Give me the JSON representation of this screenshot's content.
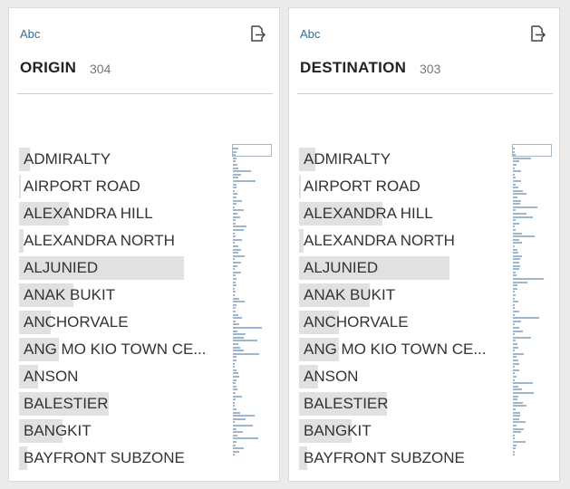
{
  "cards": [
    {
      "type_label": "Abc",
      "title": "ORIGIN",
      "count": "304",
      "values": [
        {
          "label": "ADMIRALTY",
          "freq": 0.05
        },
        {
          "label": "AIRPORT ROAD",
          "freq": 0.01
        },
        {
          "label": "ALEXANDRA HILL",
          "freq": 0.24
        },
        {
          "label": "ALEXANDRA NORTH",
          "freq": 0.02
        },
        {
          "label": "ALJUNIED",
          "freq": 0.79
        },
        {
          "label": "ANAK BUKIT",
          "freq": 0.26
        },
        {
          "label": "ANCHORVALE",
          "freq": 0.15
        },
        {
          "label": "ANG MO KIO TOWN CE...",
          "freq": 0.19
        },
        {
          "label": "ANSON",
          "freq": 0.09
        },
        {
          "label": "BALESTIER",
          "freq": 0.43
        },
        {
          "label": "BANGKIT",
          "freq": 0.21
        },
        {
          "label": "BAYFRONT SUBZONE",
          "freq": 0.04
        }
      ]
    },
    {
      "type_label": "Abc",
      "title": "DESTINATION",
      "count": "303",
      "values": [
        {
          "label": "ADMIRALTY",
          "freq": 0.08
        },
        {
          "label": "AIRPORT ROAD",
          "freq": 0.01
        },
        {
          "label": "ALEXANDRA HILL",
          "freq": 0.4
        },
        {
          "label": "ALEXANDRA NORTH",
          "freq": 0.02
        },
        {
          "label": "ALJUNIED",
          "freq": 0.72
        },
        {
          "label": "ANAK BUKIT",
          "freq": 0.34
        },
        {
          "label": "ANCHORVALE",
          "freq": 0.19
        },
        {
          "label": "ANG MO KIO TOWN CE...",
          "freq": 0.19
        },
        {
          "label": "ANSON",
          "freq": 0.09
        },
        {
          "label": "BALESTIER",
          "freq": 0.42
        },
        {
          "label": "BANGKIT",
          "freq": 0.25
        },
        {
          "label": "BAYFRONT SUBZONE",
          "freq": 0.04
        }
      ]
    }
  ],
  "colors": {
    "type_label": "#2f6f9e",
    "value_bar": "#e1e1e1",
    "mini_bar": "#9fb6cf"
  },
  "icons": {
    "export": "export-to-file-icon"
  }
}
